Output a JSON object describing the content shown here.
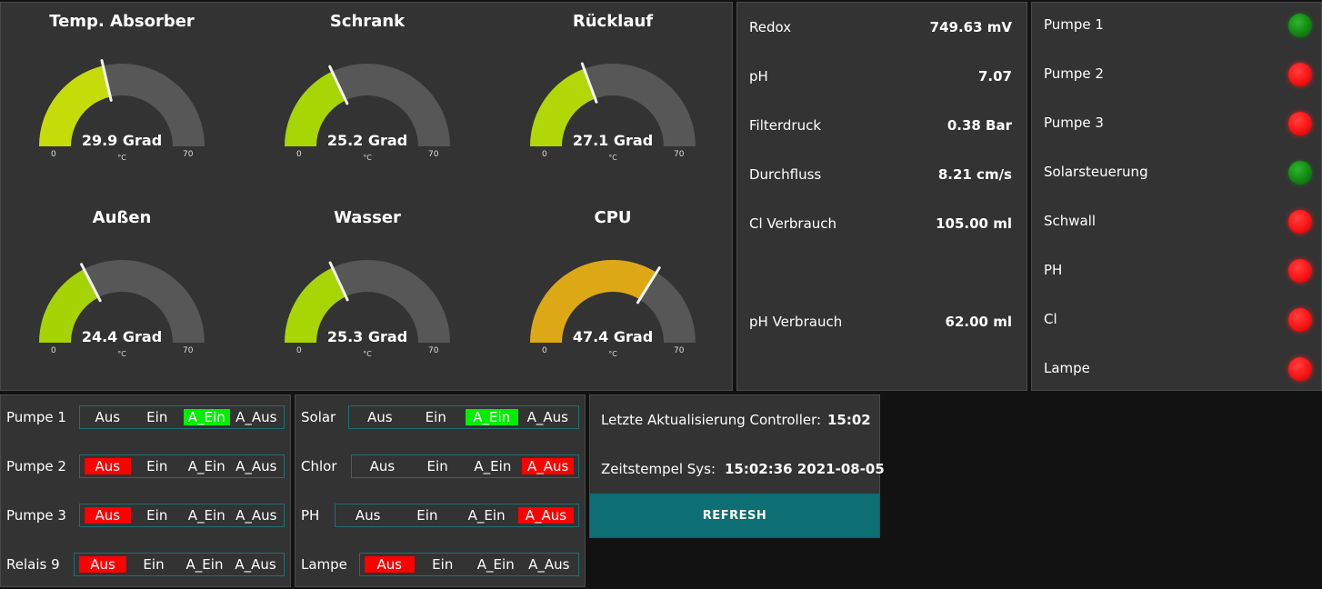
{
  "colors": {
    "gauge_green": "#b5d40a",
    "gauge_green_alt": "#a6d304",
    "gauge_amber": "#dda816",
    "gauge_track": "#575757",
    "switch_green": "#00ee00",
    "switch_red": "#ff0000",
    "refresh_teal": "#0d6e73"
  },
  "gauges": [
    {
      "title": "Temp. Absorber",
      "value": 29.9,
      "display": "29.9 Grad",
      "unit": "°C",
      "min": "0",
      "max": "70",
      "color": "#c6dc08"
    },
    {
      "title": "Schrank",
      "value": 25.2,
      "display": "25.2 Grad",
      "unit": "°C",
      "min": "0",
      "max": "70",
      "color": "#a8d504"
    },
    {
      "title": "Rücklauf",
      "value": 27.1,
      "display": "27.1 Grad",
      "unit": "°C",
      "min": "0",
      "max": "70",
      "color": "#b2d706"
    },
    {
      "title": "Außen",
      "value": 24.4,
      "display": "24.4 Grad",
      "unit": "°C",
      "min": "0",
      "max": "70",
      "color": "#a5d304"
    },
    {
      "title": "Wasser",
      "value": 25.3,
      "display": "25.3 Grad",
      "unit": "°C",
      "min": "0",
      "max": "70",
      "color": "#a8d504"
    },
    {
      "title": "CPU",
      "value": 47.4,
      "display": "47.4 Grad",
      "unit": "°C",
      "min": "0",
      "max": "70",
      "color": "#dda816"
    }
  ],
  "sensors": [
    {
      "label": "Redox",
      "value": "749.63 mV"
    },
    {
      "label": "pH",
      "value": "7.07"
    },
    {
      "label": "Filterdruck",
      "value": "0.38 Bar"
    },
    {
      "label": "Durchfluss",
      "value": "8.21 cm/s"
    },
    {
      "label": "Cl Verbrauch",
      "value": "105.00 ml"
    },
    {
      "label": "pH Verbrauch",
      "value": "62.00 ml"
    }
  ],
  "status": [
    {
      "label": "Pumpe 1",
      "state": "on"
    },
    {
      "label": "Pumpe 2",
      "state": "off"
    },
    {
      "label": "Pumpe 3",
      "state": "off"
    },
    {
      "label": "Solarsteuerung",
      "state": "on"
    },
    {
      "label": "Schwall",
      "state": "off"
    },
    {
      "label": "PH",
      "state": "off"
    },
    {
      "label": "Cl",
      "state": "off"
    },
    {
      "label": "Lampe",
      "state": "off"
    }
  ],
  "switch_options": [
    "Aus",
    "Ein",
    "A_Ein",
    "A_Aus"
  ],
  "switches_left": [
    {
      "label": "Pumpe 1",
      "active": "A_Ein",
      "active_color": "green"
    },
    {
      "label": "Pumpe 2",
      "active": "Aus",
      "active_color": "red"
    },
    {
      "label": "Pumpe 3",
      "active": "Aus",
      "active_color": "red"
    },
    {
      "label": "Relais 9",
      "active": "Aus",
      "active_color": "red"
    }
  ],
  "switches_right": [
    {
      "label": "Solar",
      "active": "A_Ein",
      "active_color": "green"
    },
    {
      "label": "Chlor",
      "active": "A_Aus",
      "active_color": "red"
    },
    {
      "label": "PH",
      "active": "A_Aus",
      "active_color": "red"
    },
    {
      "label": "Lampe",
      "active": "Aus",
      "active_color": "red"
    }
  ],
  "info": {
    "last_update_label": "Letzte Aktualisierung Controller:",
    "last_update_value": "15:02",
    "timestamp_label": "Zeitstempel Sys:",
    "timestamp_value": "15:02:36 2021-08-05",
    "refresh_label": "REFRESH"
  }
}
